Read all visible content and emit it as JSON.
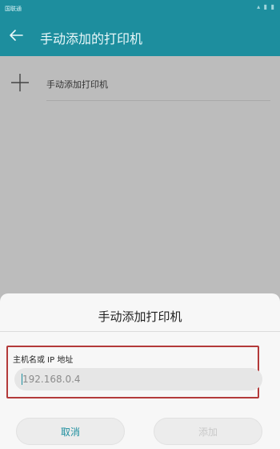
{
  "status_bar": {
    "carrier": "国联通",
    "right_icons": "signal-wifi-battery"
  },
  "app_bar": {
    "title": "手动添加的打印机",
    "back_icon": "arrow-left-icon"
  },
  "list": {
    "add_item_icon": "plus-icon",
    "add_item_label": "手动添加打印机"
  },
  "dialog": {
    "title": "手动添加打印机",
    "field_label": "主机名或 IP 地址",
    "field_placeholder": "192.168.0.4",
    "field_value": "",
    "cancel_label": "取消",
    "add_label": "添加"
  },
  "colors": {
    "accent": "#1d8e9e",
    "highlight_border": "#b33a3a"
  }
}
